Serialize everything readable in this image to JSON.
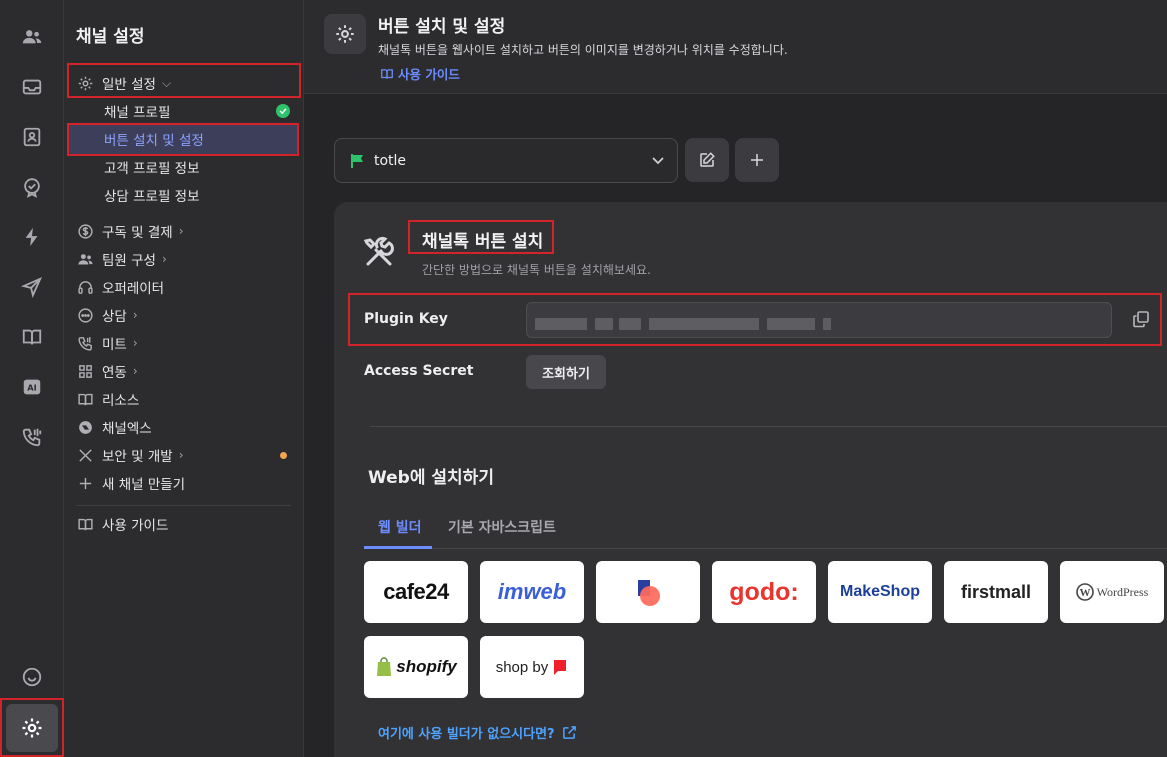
{
  "sidebar": {
    "title": "채널 설정",
    "general_settings": "일반 설정",
    "sub_items": [
      "채널 프로필",
      "버튼 설치 및 설정",
      "고객 프로필 정보",
      "상담 프로필 정보"
    ],
    "items": [
      {
        "label": "구독 및 결제",
        "icon": "dollar-icon",
        "chevron": true
      },
      {
        "label": "팀원 구성",
        "icon": "team-icon",
        "chevron": true
      },
      {
        "label": "오퍼레이터",
        "icon": "headset-icon",
        "chevron": false
      },
      {
        "label": "상담",
        "icon": "chat-icon",
        "chevron": true
      },
      {
        "label": "미트",
        "icon": "phone-icon",
        "chevron": true
      },
      {
        "label": "연동",
        "icon": "grid-icon",
        "chevron": true
      },
      {
        "label": "리소스",
        "icon": "book-icon",
        "chevron": false
      },
      {
        "label": "채널엑스",
        "icon": "channelx-icon",
        "chevron": false
      },
      {
        "label": "보안 및 개발",
        "icon": "tools-icon",
        "chevron": true
      },
      {
        "label": "새 채널 만들기",
        "icon": "plus-icon",
        "chevron": false
      }
    ],
    "guide": "사용 가이드"
  },
  "header": {
    "title": "버튼 설치 및 설정",
    "description": "채널톡 버튼을 웹사이트 설치하고 버튼의 이미지를 변경하거나 위치를 수정합니다.",
    "guide_link": "사용 가이드"
  },
  "channel_select": {
    "value": "totle"
  },
  "card": {
    "title": "채널톡 버튼 설치",
    "subtitle": "간단한 방법으로 채널톡 버튼을 설치해보세요.",
    "plugin_key_label": "Plugin Key",
    "access_secret_label": "Access Secret",
    "lookup_button": "조회하기",
    "web_title": "Web에 설치하기",
    "tabs": [
      "웹 빌더",
      "기본 자바스크립트"
    ],
    "builders": [
      "cafe24",
      "imweb",
      "",
      "godo:",
      "MakeShop",
      "firstmall",
      "WordPress",
      "shopify",
      "shop by"
    ],
    "builder_link": "여기에 사용 빌더가 없으시다면?"
  },
  "colors": {
    "accent": "#6d8cff",
    "link": "#4da3ff",
    "highlight": "#d2232a",
    "success": "#2ec26a"
  }
}
